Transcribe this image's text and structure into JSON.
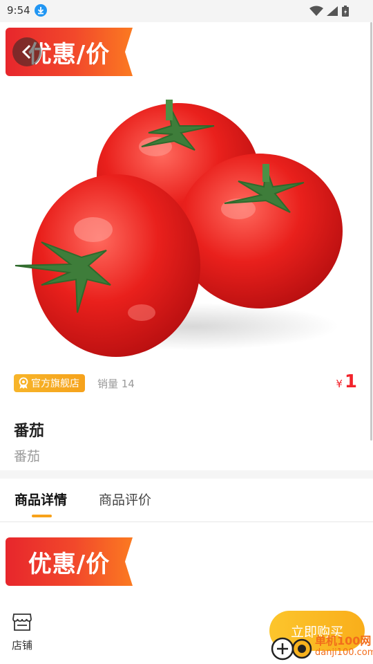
{
  "status_bar": {
    "time": "9:54"
  },
  "hero": {
    "promo_text": "优惠/价"
  },
  "product": {
    "store_badge": "官方旗舰店",
    "sales": "销量 14",
    "currency_symbol": "¥",
    "price": "1",
    "title": "番茄",
    "subtitle": "番茄"
  },
  "tabs": [
    {
      "label": "商品详情",
      "active": true
    },
    {
      "label": "商品评价",
      "active": false
    }
  ],
  "detail": {
    "promo_text": "优惠/价"
  },
  "bottom_bar": {
    "shop_label": "店铺",
    "buy_label": "立即购买"
  },
  "watermark": {
    "text": "单机100网",
    "sub": "danji100.com"
  },
  "colors": {
    "price": "#f2232b",
    "accent": "#f9ae1b",
    "promo_red": "#e7262c"
  },
  "icons": [
    "download-icon",
    "wifi-icon",
    "signal-icon",
    "battery-icon",
    "back-arrow-icon",
    "badge-icon",
    "store-icon"
  ]
}
